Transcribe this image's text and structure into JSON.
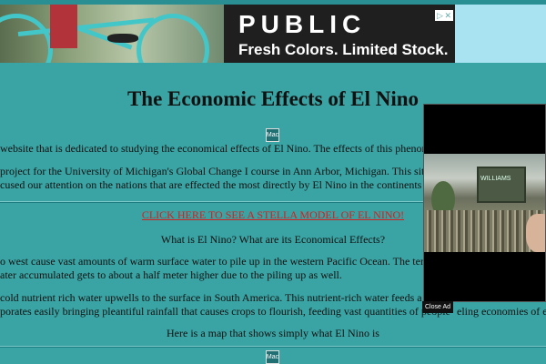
{
  "ad": {
    "headline": "PUBLIC",
    "subline": "Fresh Colors. Limited Stock.",
    "adchoices_icon": "adchoices-icon"
  },
  "page": {
    "title": "The Economic Effects of El Nino",
    "intro_lines": [
      "website that is dedicated to studying the economical effects of El Nino. The effects of this phenomenon",
      "project for the University of Michigan's Global Change I course in Ann Arbor, Michigan. This site wa",
      "cused our attention on the nations that are effected the most directly by El Nino in the continents of No"
    ],
    "stella_link": "CLICK HERE TO SEE A STELLA MODEL OF EL NINO!",
    "question": "What is El Nino? What are its Economical Effects?",
    "para1_lines": [
      "o west cause vast amounts of warm surface water to pile up in the western Pacific Ocean. The tempera",
      "ater accumulated gets to about a half meter higher due to the piling up as well."
    ],
    "para2_lines": [
      "cold nutrient rich water upwells to the surface in South America. This nutrient-rich water feeds a vast",
      "porates easily bringing pleantiful rainfall that causes crops to flourish, feeding vast quantities of people",
      "eling economies of en"
    ],
    "map_caption": "Here is a map that shows simply what El Nino is"
  },
  "video_ad": {
    "sign_text": "WILLIAMS",
    "close_label": "Close Ad"
  },
  "icons": {
    "broken_image": "Mac"
  },
  "colors": {
    "background": "#3aa3a3",
    "link": "#d81e1e"
  }
}
